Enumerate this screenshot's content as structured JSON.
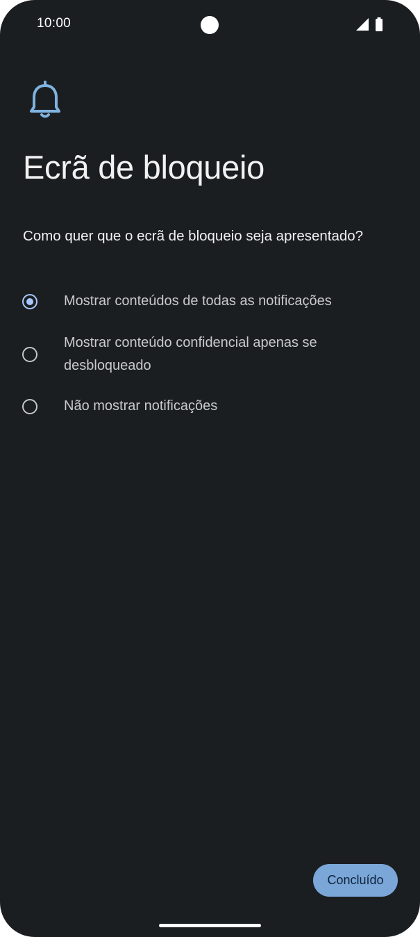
{
  "status_bar": {
    "time": "10:00",
    "icons": [
      "signal-icon",
      "battery-icon"
    ]
  },
  "header": {
    "icon": "bell-icon",
    "title": "Ecrã de bloqueio"
  },
  "question": "Como quer que o ecrã de bloqueio seja apresentado?",
  "options": [
    {
      "label": "Mostrar conteúdos de todas as notificações",
      "selected": true
    },
    {
      "label": "Mostrar conteúdo confidencial apenas se desbloqueado",
      "selected": false
    },
    {
      "label": "Não mostrar notificações",
      "selected": false
    }
  ],
  "footer": {
    "done_label": "Concluído"
  },
  "colors": {
    "background": "#1b1e21",
    "accent": "#a8c7fa",
    "button": "#7aa6d8",
    "bell": "#7fb3e0"
  }
}
